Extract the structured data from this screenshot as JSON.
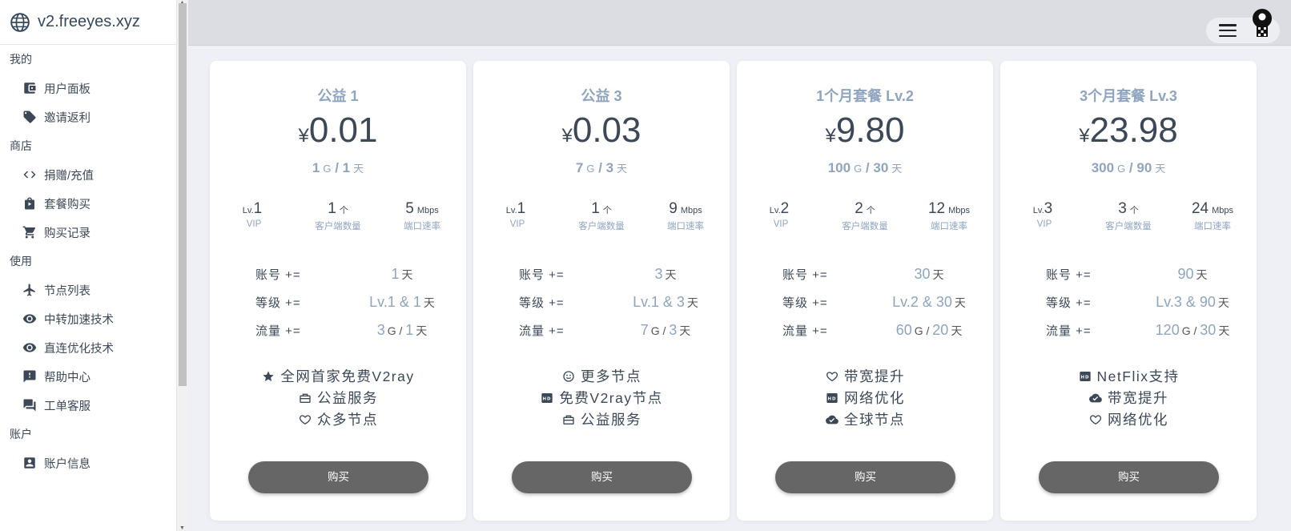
{
  "brand": {
    "title": "v2.freeyes.xyz",
    "icon": "globe-icon"
  },
  "sidebar": {
    "sections": [
      {
        "title": "我的",
        "items": [
          {
            "label": "用户面板",
            "icon": "wallet-icon"
          },
          {
            "label": "邀请返利",
            "icon": "tag-icon"
          }
        ]
      },
      {
        "title": "商店",
        "items": [
          {
            "label": "捐赠/充值",
            "icon": "code-icon"
          },
          {
            "label": "套餐购买",
            "icon": "shopping-bag-icon"
          },
          {
            "label": "购买记录",
            "icon": "cart-icon"
          }
        ]
      },
      {
        "title": "使用",
        "items": [
          {
            "label": "节点列表",
            "icon": "airplane-icon"
          },
          {
            "label": "中转加速技术",
            "icon": "eye-icon"
          },
          {
            "label": "直连优化技术",
            "icon": "eye-icon"
          },
          {
            "label": "帮助中心",
            "icon": "feedback-icon"
          },
          {
            "label": "工单客服",
            "icon": "forum-icon"
          }
        ]
      },
      {
        "title": "账户",
        "items": [
          {
            "label": "账户信息",
            "icon": "account-box-icon"
          }
        ]
      }
    ]
  },
  "topbar": {
    "menu_icon": "menu-icon",
    "avatar_icon": "avatar-icon"
  },
  "plans": [
    {
      "name": "公益 1",
      "currency": "¥",
      "price": "0.01",
      "quota": {
        "traffic": "1",
        "traffic_unit": "G",
        "days": "1",
        "days_unit": "天"
      },
      "stats": [
        {
          "prefix": "Lv.",
          "value": "1",
          "unit": "",
          "label": "VIP"
        },
        {
          "prefix": "",
          "value": "1",
          "unit": "个",
          "label": "客户端数量"
        },
        {
          "prefix": "",
          "value": "5",
          "unit": "Mbps",
          "label": "端口速率"
        }
      ],
      "details": [
        {
          "key": "账号 +=",
          "value": "1",
          "unit": "天"
        },
        {
          "key": "等级 +=",
          "value": "Lv.1 & 1",
          "unit": "天"
        },
        {
          "key": "流量 +=",
          "value": "3",
          "unit": "G",
          "value2": "1",
          "unit2": "天"
        }
      ],
      "features": [
        {
          "icon": "star-icon",
          "text": "全网首家免费V2ray"
        },
        {
          "icon": "charity-icon",
          "text": "公益服务"
        },
        {
          "icon": "heart-icon",
          "text": "众多节点"
        }
      ],
      "buy_label": "购买"
    },
    {
      "name": "公益 3",
      "currency": "¥",
      "price": "0.03",
      "quota": {
        "traffic": "7",
        "traffic_unit": "G",
        "days": "3",
        "days_unit": "天"
      },
      "stats": [
        {
          "prefix": "Lv.",
          "value": "1",
          "unit": "",
          "label": "VIP"
        },
        {
          "prefix": "",
          "value": "1",
          "unit": "个",
          "label": "客户端数量"
        },
        {
          "prefix": "",
          "value": "9",
          "unit": "Mbps",
          "label": "端口速率"
        }
      ],
      "details": [
        {
          "key": "账号 +=",
          "value": "3",
          "unit": "天"
        },
        {
          "key": "等级 +=",
          "value": "Lv.1 & 3",
          "unit": "天"
        },
        {
          "key": "流量 +=",
          "value": "7",
          "unit": "G",
          "value2": "3",
          "unit2": "天"
        }
      ],
      "features": [
        {
          "icon": "smile-icon",
          "text": "更多节点"
        },
        {
          "icon": "hd-icon",
          "text": "免费V2ray节点"
        },
        {
          "icon": "charity-icon",
          "text": "公益服务"
        }
      ],
      "buy_label": "购买"
    },
    {
      "name": "1个月套餐 Lv.2",
      "currency": "¥",
      "price": "9.80",
      "quota": {
        "traffic": "100",
        "traffic_unit": "G",
        "days": "30",
        "days_unit": "天"
      },
      "stats": [
        {
          "prefix": "Lv.",
          "value": "2",
          "unit": "",
          "label": "VIP"
        },
        {
          "prefix": "",
          "value": "2",
          "unit": "个",
          "label": "客户端数量"
        },
        {
          "prefix": "",
          "value": "12",
          "unit": "Mbps",
          "label": "端口速率"
        }
      ],
      "details": [
        {
          "key": "账号 +=",
          "value": "30",
          "unit": "天"
        },
        {
          "key": "等级 +=",
          "value": "Lv.2 & 30",
          "unit": "天"
        },
        {
          "key": "流量 +=",
          "value": "60",
          "unit": "G",
          "value2": "20",
          "unit2": "天"
        }
      ],
      "features": [
        {
          "icon": "heart-icon",
          "text": "带宽提升"
        },
        {
          "icon": "hd-icon",
          "text": "网络优化"
        },
        {
          "icon": "cloud-done-icon",
          "text": "全球节点"
        }
      ],
      "buy_label": "购买"
    },
    {
      "name": "3个月套餐 Lv.3",
      "currency": "¥",
      "price": "23.98",
      "quota": {
        "traffic": "300",
        "traffic_unit": "G",
        "days": "90",
        "days_unit": "天"
      },
      "stats": [
        {
          "prefix": "Lv.",
          "value": "3",
          "unit": "",
          "label": "VIP"
        },
        {
          "prefix": "",
          "value": "3",
          "unit": "个",
          "label": "客户端数量"
        },
        {
          "prefix": "",
          "value": "24",
          "unit": "Mbps",
          "label": "端口速率"
        }
      ],
      "details": [
        {
          "key": "账号 +=",
          "value": "90",
          "unit": "天"
        },
        {
          "key": "等级 +=",
          "value": "Lv.3 & 90",
          "unit": "天"
        },
        {
          "key": "流量 +=",
          "value": "120",
          "unit": "G",
          "value2": "30",
          "unit2": "天"
        }
      ],
      "features": [
        {
          "icon": "hd-icon",
          "text": "NetFlix支持"
        },
        {
          "icon": "cloud-done-icon",
          "text": "带宽提升"
        },
        {
          "icon": "heart-icon",
          "text": "网络优化"
        }
      ],
      "buy_label": "购买"
    }
  ]
}
